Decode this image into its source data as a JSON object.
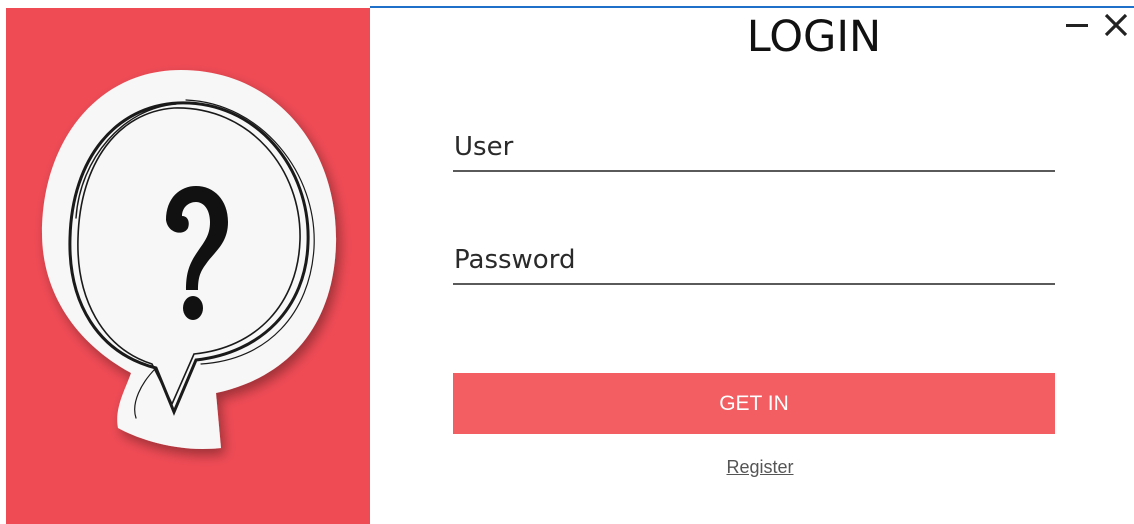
{
  "window": {
    "title": "LOGIN",
    "controls": {
      "minimize_icon": "minimize-icon",
      "close_icon": "close-icon"
    }
  },
  "illustration": {
    "icon": "question-speech-bubble",
    "glyph": "?",
    "background_color": "#ef4b55"
  },
  "form": {
    "user": {
      "placeholder": "User",
      "value": ""
    },
    "password": {
      "placeholder": "Password",
      "value": ""
    },
    "submit_label": "GET IN",
    "register_label": "Register"
  },
  "colors": {
    "accent": "#f25e62",
    "title_text": "#111111",
    "field_underline": "#5a5a5a",
    "window_border": "#1f70c8"
  }
}
